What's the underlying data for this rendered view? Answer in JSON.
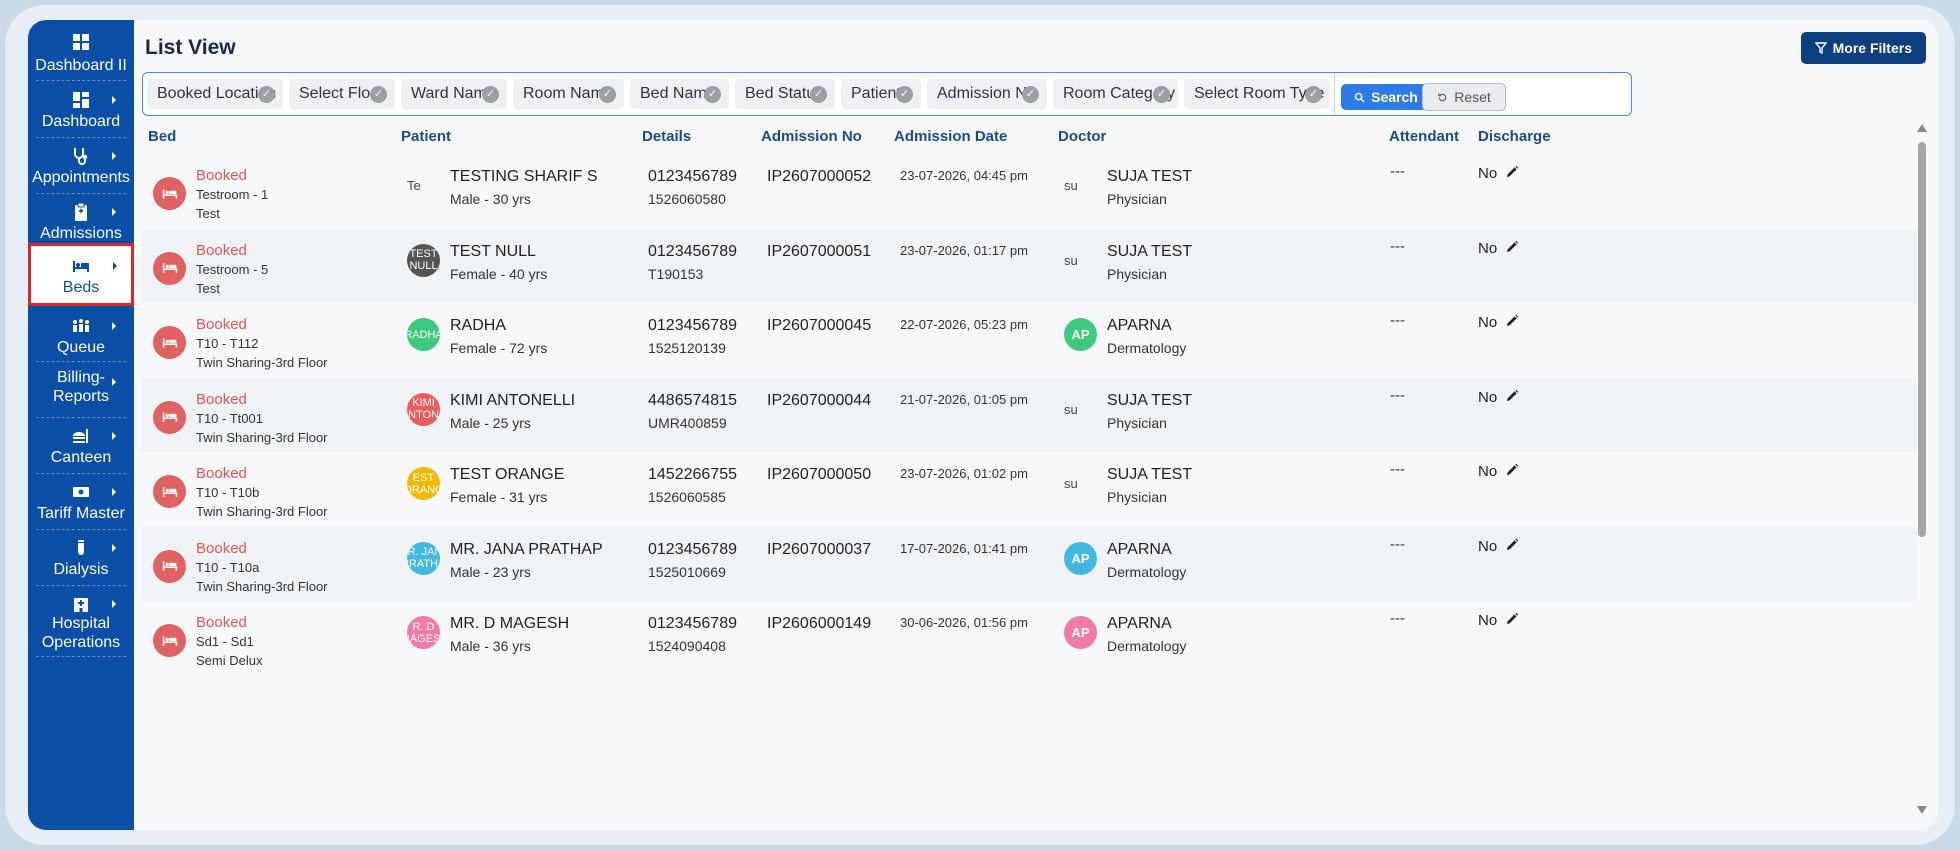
{
  "sidebar": {
    "items": [
      {
        "label": "Dashboard II",
        "icon": "grid-icon"
      },
      {
        "label": "Dashboard",
        "icon": "dashboard-icon"
      },
      {
        "label": "Appointments",
        "icon": "stethoscope-icon"
      },
      {
        "label": "Admissions",
        "icon": "clipboard-icon"
      },
      {
        "label": "Beds",
        "icon": "bed-icon"
      },
      {
        "label": "Queue",
        "icon": "people-queue-icon"
      },
      {
        "label": "Billing-Reports",
        "label2": "Reports",
        "icon": "billing-icon"
      },
      {
        "label": "Canteen",
        "icon": "canteen-icon"
      },
      {
        "label": "Tariff Master",
        "icon": "money-icon"
      },
      {
        "label": "Dialysis",
        "icon": "dialysis-icon"
      },
      {
        "label": "Hospital",
        "label2": "Operations",
        "icon": "hospital-icon"
      }
    ],
    "billing_line1": "Billing-",
    "billing_line2": "Reports",
    "hospital_line1": "Hospital",
    "hospital_line2": "Operations"
  },
  "header": {
    "title": "List View",
    "more_filters": "More Filters"
  },
  "filters": {
    "chips": [
      "Booked Location",
      "Select Floor",
      "Ward Name",
      "Room Name",
      "Bed Name",
      "Bed Status",
      "Patient",
      "Admission No",
      "Room Category",
      "Select Room Type"
    ],
    "search_label": "Search",
    "reset_label": "Reset"
  },
  "table": {
    "columns": [
      "Bed",
      "Patient",
      "Details",
      "Admission No",
      "Admission Date",
      "Doctor",
      "Attendant",
      "Discharge"
    ],
    "rows": [
      {
        "status": "Booked",
        "room": "Testroom - 1",
        "bed_type": "Test",
        "patient_avatar": "Te",
        "patient_avatar_broken": true,
        "patient_avatar_color": "",
        "patient": "TESTING SHARIF S",
        "patient_sub": "Male - 30 yrs",
        "phone": "0123456789",
        "code": "1526060580",
        "admission_no": "IP2607000052",
        "admission_date": "23-07-2026, 04:45 pm",
        "doctor_avatar": "su",
        "doctor_avatar_broken": true,
        "doctor_avatar_color": "",
        "doctor": "SUJA TEST",
        "doctor_spec": "Physician",
        "attendant": "---",
        "discharge": "No"
      },
      {
        "status": "Booked",
        "room": "Testroom - 5",
        "bed_type": "Test",
        "patient_avatar": "TEST NULL",
        "patient_avatar_broken": false,
        "patient_avatar_color": "#555555",
        "patient": "TEST NULL",
        "patient_sub": "Female - 40 yrs",
        "phone": "0123456789",
        "code": "T190153",
        "admission_no": "IP2607000051",
        "admission_date": "23-07-2026, 01:17 pm",
        "doctor_avatar": "su",
        "doctor_avatar_broken": true,
        "doctor_avatar_color": "",
        "doctor": "SUJA TEST",
        "doctor_spec": "Physician",
        "attendant": "---",
        "discharge": "No"
      },
      {
        "status": "Booked",
        "room": "T10 - T112",
        "bed_type": "Twin Sharing-3rd Floor",
        "patient_avatar": "RADHA",
        "patient_avatar_broken": false,
        "patient_avatar_color": "#3ec97f",
        "patient": "RADHA",
        "patient_sub": "Female - 72 yrs",
        "phone": "0123456789",
        "code": "1525120139",
        "admission_no": "IP2607000045",
        "admission_date": "22-07-2026, 05:23 pm",
        "doctor_avatar": "AP",
        "doctor_avatar_broken": false,
        "doctor_avatar_color": "#3ec97f",
        "doctor": "APARNA",
        "doctor_spec": "Dermatology",
        "attendant": "---",
        "discharge": "No"
      },
      {
        "status": "Booked",
        "room": "T10 - Tt001",
        "bed_type": "Twin Sharing-3rd Floor",
        "patient_avatar": "KIMI ANTONE",
        "patient_avatar_broken": false,
        "patient_avatar_color": "#ef5a5a",
        "patient": "KIMI ANTONELLI",
        "patient_sub": "Male - 25 yrs",
        "phone": "4486574815",
        "code": "UMR400859",
        "admission_no": "IP2607000044",
        "admission_date": "21-07-2026, 01:05 pm",
        "doctor_avatar": "su",
        "doctor_avatar_broken": true,
        "doctor_avatar_color": "",
        "doctor": "SUJA TEST",
        "doctor_spec": "Physician",
        "attendant": "---",
        "discharge": "No"
      },
      {
        "status": "Booked",
        "room": "T10 - T10b",
        "bed_type": "Twin Sharing-3rd Floor",
        "patient_avatar": "EST ORANG",
        "patient_avatar_broken": false,
        "patient_avatar_color": "#f5b800",
        "patient": "TEST ORANGE",
        "patient_sub": "Female - 31 yrs",
        "phone": "1452266755",
        "code": "1526060585",
        "admission_no": "IP2607000050",
        "admission_date": "23-07-2026, 01:02 pm",
        "doctor_avatar": "su",
        "doctor_avatar_broken": true,
        "doctor_avatar_color": "",
        "doctor": "SUJA TEST",
        "doctor_spec": "Physician",
        "attendant": "---",
        "discharge": "No"
      },
      {
        "status": "Booked",
        "room": "T10 - T10a",
        "bed_type": "Twin Sharing-3rd Floor",
        "patient_avatar": "IR. JAN PRATHA",
        "patient_avatar_broken": false,
        "patient_avatar_color": "#42b8e0",
        "patient": "MR. JANA PRATHAP",
        "patient_sub": "Male - 23 yrs",
        "phone": "0123456789",
        "code": "1525010669",
        "admission_no": "IP2607000037",
        "admission_date": "17-07-2026, 01:41 pm",
        "doctor_avatar": "AP",
        "doctor_avatar_broken": false,
        "doctor_avatar_color": "#42b8e0",
        "doctor": "APARNA",
        "doctor_spec": "Dermatology",
        "attendant": "---",
        "discharge": "No"
      },
      {
        "status": "Booked",
        "room": "Sd1 - Sd1",
        "bed_type": "Semi Delux",
        "patient_avatar": "R. D IAGES",
        "patient_avatar_broken": false,
        "patient_avatar_color": "#f07aa8",
        "patient": "MR. D MAGESH",
        "patient_sub": "Male - 36 yrs",
        "phone": "0123456789",
        "code": "1524090408",
        "admission_no": "IP2606000149",
        "admission_date": "30-06-2026, 01:56 pm",
        "doctor_avatar": "AP",
        "doctor_avatar_broken": false,
        "doctor_avatar_color": "#f07aa8",
        "doctor": "APARNA",
        "doctor_spec": "Dermatology",
        "attendant": "---",
        "discharge": "No"
      }
    ]
  },
  "colors": {
    "sidebar": "#0a4ea6",
    "accent": "#2d7be5",
    "booked": "#e05757",
    "more_filters_bg": "#0d3f7e"
  }
}
